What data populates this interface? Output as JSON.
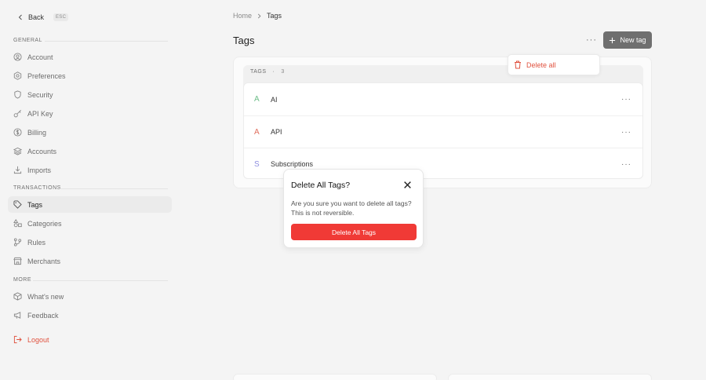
{
  "sidebar": {
    "back_label": "Back",
    "esc_label": "ESC",
    "sections": {
      "general": "GENERAL",
      "transactions": "TRANSACTIONS",
      "more": "MORE"
    },
    "general_items": [
      "Account",
      "Preferences",
      "Security",
      "API Key",
      "Billing",
      "Accounts",
      "Imports"
    ],
    "transaction_items": [
      "Tags",
      "Categories",
      "Rules",
      "Merchants"
    ],
    "more_items": [
      "What's new",
      "Feedback"
    ],
    "logout_label": "Logout",
    "active_item": "Tags"
  },
  "breadcrumb": {
    "home": "Home",
    "current": "Tags"
  },
  "page": {
    "title": "Tags"
  },
  "toolbar": {
    "new_tag_label": "New tag",
    "more_label": "···"
  },
  "dropdown": {
    "delete_all_label": "Delete all"
  },
  "tags": {
    "header_label": "TAGS",
    "count": "3",
    "items": [
      {
        "letter": "A",
        "name": "AI",
        "color": "#6fbf8a"
      },
      {
        "letter": "A",
        "name": "API",
        "color": "#e0705f"
      },
      {
        "letter": "S",
        "name": "Subscriptions",
        "color": "#8f8fe0"
      }
    ]
  },
  "modal": {
    "title": "Delete All Tags?",
    "body": "Are you sure you want to delete all tags? This is not reversible.",
    "confirm_label": "Delete All Tags"
  },
  "colors": {
    "danger": "#f03a36",
    "logout": "#e0523f",
    "primary_button": "#6f6f6f"
  }
}
